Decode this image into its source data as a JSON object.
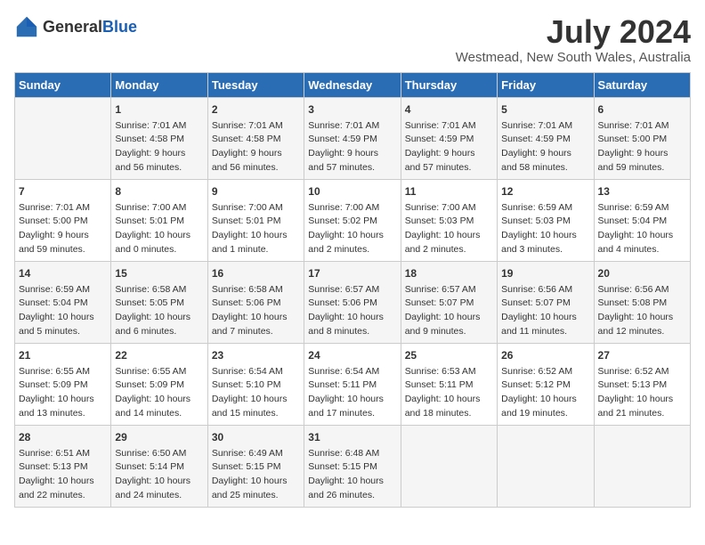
{
  "logo": {
    "general": "General",
    "blue": "Blue"
  },
  "title": "July 2024",
  "subtitle": "Westmead, New South Wales, Australia",
  "days_of_week": [
    "Sunday",
    "Monday",
    "Tuesday",
    "Wednesday",
    "Thursday",
    "Friday",
    "Saturday"
  ],
  "weeks": [
    [
      {
        "day": "",
        "info": ""
      },
      {
        "day": "1",
        "info": "Sunrise: 7:01 AM\nSunset: 4:58 PM\nDaylight: 9 hours\nand 56 minutes."
      },
      {
        "day": "2",
        "info": "Sunrise: 7:01 AM\nSunset: 4:58 PM\nDaylight: 9 hours\nand 56 minutes."
      },
      {
        "day": "3",
        "info": "Sunrise: 7:01 AM\nSunset: 4:59 PM\nDaylight: 9 hours\nand 57 minutes."
      },
      {
        "day": "4",
        "info": "Sunrise: 7:01 AM\nSunset: 4:59 PM\nDaylight: 9 hours\nand 57 minutes."
      },
      {
        "day": "5",
        "info": "Sunrise: 7:01 AM\nSunset: 4:59 PM\nDaylight: 9 hours\nand 58 minutes."
      },
      {
        "day": "6",
        "info": "Sunrise: 7:01 AM\nSunset: 5:00 PM\nDaylight: 9 hours\nand 59 minutes."
      }
    ],
    [
      {
        "day": "7",
        "info": "Sunrise: 7:01 AM\nSunset: 5:00 PM\nDaylight: 9 hours\nand 59 minutes."
      },
      {
        "day": "8",
        "info": "Sunrise: 7:00 AM\nSunset: 5:01 PM\nDaylight: 10 hours\nand 0 minutes."
      },
      {
        "day": "9",
        "info": "Sunrise: 7:00 AM\nSunset: 5:01 PM\nDaylight: 10 hours\nand 1 minute."
      },
      {
        "day": "10",
        "info": "Sunrise: 7:00 AM\nSunset: 5:02 PM\nDaylight: 10 hours\nand 2 minutes."
      },
      {
        "day": "11",
        "info": "Sunrise: 7:00 AM\nSunset: 5:03 PM\nDaylight: 10 hours\nand 2 minutes."
      },
      {
        "day": "12",
        "info": "Sunrise: 6:59 AM\nSunset: 5:03 PM\nDaylight: 10 hours\nand 3 minutes."
      },
      {
        "day": "13",
        "info": "Sunrise: 6:59 AM\nSunset: 5:04 PM\nDaylight: 10 hours\nand 4 minutes."
      }
    ],
    [
      {
        "day": "14",
        "info": "Sunrise: 6:59 AM\nSunset: 5:04 PM\nDaylight: 10 hours\nand 5 minutes."
      },
      {
        "day": "15",
        "info": "Sunrise: 6:58 AM\nSunset: 5:05 PM\nDaylight: 10 hours\nand 6 minutes."
      },
      {
        "day": "16",
        "info": "Sunrise: 6:58 AM\nSunset: 5:06 PM\nDaylight: 10 hours\nand 7 minutes."
      },
      {
        "day": "17",
        "info": "Sunrise: 6:57 AM\nSunset: 5:06 PM\nDaylight: 10 hours\nand 8 minutes."
      },
      {
        "day": "18",
        "info": "Sunrise: 6:57 AM\nSunset: 5:07 PM\nDaylight: 10 hours\nand 9 minutes."
      },
      {
        "day": "19",
        "info": "Sunrise: 6:56 AM\nSunset: 5:07 PM\nDaylight: 10 hours\nand 11 minutes."
      },
      {
        "day": "20",
        "info": "Sunrise: 6:56 AM\nSunset: 5:08 PM\nDaylight: 10 hours\nand 12 minutes."
      }
    ],
    [
      {
        "day": "21",
        "info": "Sunrise: 6:55 AM\nSunset: 5:09 PM\nDaylight: 10 hours\nand 13 minutes."
      },
      {
        "day": "22",
        "info": "Sunrise: 6:55 AM\nSunset: 5:09 PM\nDaylight: 10 hours\nand 14 minutes."
      },
      {
        "day": "23",
        "info": "Sunrise: 6:54 AM\nSunset: 5:10 PM\nDaylight: 10 hours\nand 15 minutes."
      },
      {
        "day": "24",
        "info": "Sunrise: 6:54 AM\nSunset: 5:11 PM\nDaylight: 10 hours\nand 17 minutes."
      },
      {
        "day": "25",
        "info": "Sunrise: 6:53 AM\nSunset: 5:11 PM\nDaylight: 10 hours\nand 18 minutes."
      },
      {
        "day": "26",
        "info": "Sunrise: 6:52 AM\nSunset: 5:12 PM\nDaylight: 10 hours\nand 19 minutes."
      },
      {
        "day": "27",
        "info": "Sunrise: 6:52 AM\nSunset: 5:13 PM\nDaylight: 10 hours\nand 21 minutes."
      }
    ],
    [
      {
        "day": "28",
        "info": "Sunrise: 6:51 AM\nSunset: 5:13 PM\nDaylight: 10 hours\nand 22 minutes."
      },
      {
        "day": "29",
        "info": "Sunrise: 6:50 AM\nSunset: 5:14 PM\nDaylight: 10 hours\nand 24 minutes."
      },
      {
        "day": "30",
        "info": "Sunrise: 6:49 AM\nSunset: 5:15 PM\nDaylight: 10 hours\nand 25 minutes."
      },
      {
        "day": "31",
        "info": "Sunrise: 6:48 AM\nSunset: 5:15 PM\nDaylight: 10 hours\nand 26 minutes."
      },
      {
        "day": "",
        "info": ""
      },
      {
        "day": "",
        "info": ""
      },
      {
        "day": "",
        "info": ""
      }
    ]
  ]
}
